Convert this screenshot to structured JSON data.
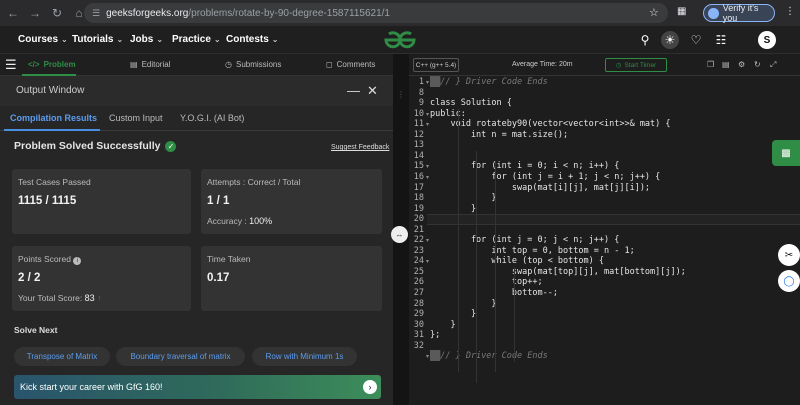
{
  "browser": {
    "url_host": "geeksforgeeks.org",
    "url_path": "/problems/rotate-by-90-degree-1587115621/1",
    "verify_label": "Verify it's you"
  },
  "header": {
    "menus": [
      "Courses",
      "Tutorials",
      "Jobs",
      "Practice",
      "Contests"
    ],
    "user_initial": "S"
  },
  "problem_tabs": [
    "Problem",
    "Editorial",
    "Submissions",
    "Comments"
  ],
  "output": {
    "title": "Output Window",
    "tabs": [
      "Compilation Results",
      "Custom Input",
      "Y.O.G.I. (AI Bot)"
    ],
    "status": "Problem Solved Successfully",
    "suggest_feedback": "Suggest Feedback",
    "cards": {
      "tests_label": "Test Cases Passed",
      "tests_value": "1115 / 1115",
      "attempts_label": "Attempts : Correct / Total",
      "attempts_value": "1 / 1",
      "accuracy_label": "Accuracy :",
      "accuracy_value": "100%",
      "points_label": "Points Scored",
      "points_value": "2 / 2",
      "total_score_label": "Your Total Score:",
      "total_score_value": "83",
      "time_label": "Time Taken",
      "time_value": "0.17"
    },
    "solve_next_title": "Solve Next",
    "solve_next": [
      "Transpose of Matrix",
      "Boundary traversal of matrix",
      "Row with Minimum 1s"
    ],
    "promo": "Kick start your career with GfG 160!"
  },
  "editor": {
    "language": "C++ (g++ 5.4)",
    "avg_time": "Average Time: 20m",
    "timer": "Start Timer",
    "lines": [
      {
        "n": "1",
        "text": "// } Driver Code Ends",
        "comment": true,
        "arrow": true
      },
      {
        "n": "8",
        "text": "",
        "arrow": false
      },
      {
        "n": "9",
        "text": "class Solution {",
        "arrow": false
      },
      {
        "n": "10",
        "text": "public:",
        "arrow": true
      },
      {
        "n": "11",
        "text": "    void rotateby90(vector<vector<int>>& mat) {",
        "arrow": true
      },
      {
        "n": "12",
        "text": "        int n = mat.size();",
        "arrow": false
      },
      {
        "n": "13",
        "text": "",
        "arrow": false
      },
      {
        "n": "14",
        "text": "",
        "arrow": false
      },
      {
        "n": "15",
        "text": "        for (int i = 0; i < n; i++) {",
        "arrow": true
      },
      {
        "n": "16",
        "text": "            for (int j = i + 1; j < n; j++) {",
        "arrow": true
      },
      {
        "n": "17",
        "text": "                swap(mat[i][j], mat[j][i]);",
        "arrow": false
      },
      {
        "n": "18",
        "text": "            }",
        "arrow": false
      },
      {
        "n": "19",
        "text": "        }",
        "arrow": false
      },
      {
        "n": "20",
        "text": "",
        "arrow": false
      },
      {
        "n": "21",
        "text": "",
        "arrow": false
      },
      {
        "n": "22",
        "text": "        for (int j = 0; j < n; j++) {",
        "arrow": true
      },
      {
        "n": "23",
        "text": "            int top = 0, bottom = n - 1;",
        "arrow": false
      },
      {
        "n": "24",
        "text": "            while (top < bottom) {",
        "arrow": true
      },
      {
        "n": "25",
        "text": "                swap(mat[top][j], mat[bottom][j]);",
        "arrow": false
      },
      {
        "n": "26",
        "text": "                top++;",
        "arrow": false
      },
      {
        "n": "27",
        "text": "                bottom--;",
        "arrow": false
      },
      {
        "n": "28",
        "text": "            }",
        "arrow": false
      },
      {
        "n": "29",
        "text": "        }",
        "arrow": false
      },
      {
        "n": "30",
        "text": "    }",
        "arrow": false
      },
      {
        "n": "31",
        "text": "};",
        "arrow": false
      },
      {
        "n": "32",
        "text": "",
        "arrow": false
      },
      {
        "n": "",
        "text": "// } Driver Code Ends",
        "comment": true,
        "arrow": true
      }
    ]
  },
  "colors": {
    "gfg_green": "#2f8d46",
    "link_blue": "#5b9cf0"
  }
}
